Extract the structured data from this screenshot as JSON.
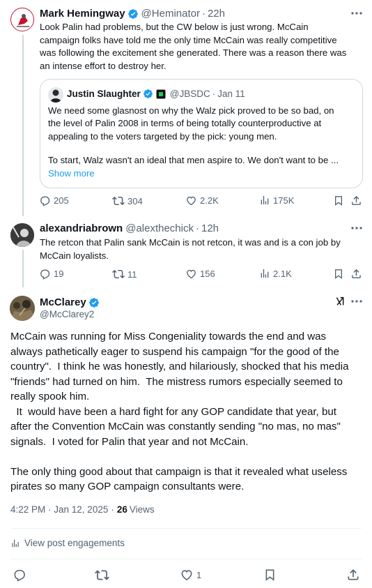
{
  "post1": {
    "display_name": "Mark Hemingway",
    "handle": "@Heminator",
    "time": "22h",
    "text_lines": [
      "Look Palin had problems, but the CW below is just wrong. McCain",
      "campaign folks have told me the only time McCain was really competitive",
      "was following the excitement she generated. There was a reason there was",
      "an intense effort to destroy her."
    ],
    "quote": {
      "display_name": "Justin Slaughter",
      "handle": "@JBSDC",
      "time": "Jan 11",
      "text_lines": [
        "We need some glasnost on why the Walz pick proved to be so bad, on",
        "the level of Palin 2008 in terms of being totally counterproductive at",
        "appealing to the voters targeted by the pick: young men."
      ],
      "text_line_2": "To start, Walz wasn't an ideal that men aspire to. We don't want to be ...",
      "show_more": "Show more"
    },
    "counts": {
      "replies": "205",
      "reposts": "304",
      "likes": "2.2K",
      "views": "175K"
    }
  },
  "post2": {
    "display_name": "alexandriabrown",
    "handle": "@alexthechick",
    "time": "12h",
    "text_lines": [
      "The retcon that Palin sank McCain is not retcon, it was and is a con job by",
      "McCain loyalists."
    ],
    "counts": {
      "replies": "19",
      "reposts": "11",
      "likes": "156",
      "views": "2.1K"
    }
  },
  "main_post": {
    "display_name": "McClarey",
    "handle": "@McClarey2",
    "text_lines": [
      "McCain was running for Miss Congeniality towards the end and was",
      "always pathetically eager to suspend his campaign \"for the good of the",
      "country\".  I think he was honestly, and hilariously, shocked that his media",
      "\"friends\" had turned on him.  The mistress rumors especially seemed to",
      "really spook him.",
      "  It  would have been a hard fight for any GOP candidate that year, but",
      "after the Convention McCain was constantly sending \"no mas, no mas\"",
      "signals.  I voted for Palin that year and not McCain.",
      "",
      "The only thing good about that campaign is that it revealed what useless",
      "pirates so many GOP campaign consultants were."
    ],
    "timestamp": "4:22 PM · Jan 12, 2025",
    "views_count": "26",
    "views_label": "Views",
    "engagements_label": "View post engagements",
    "likes": "1"
  },
  "colors": {
    "verified": "#1d9bf0",
    "link": "#1d9bf0",
    "muted": "#536471"
  }
}
